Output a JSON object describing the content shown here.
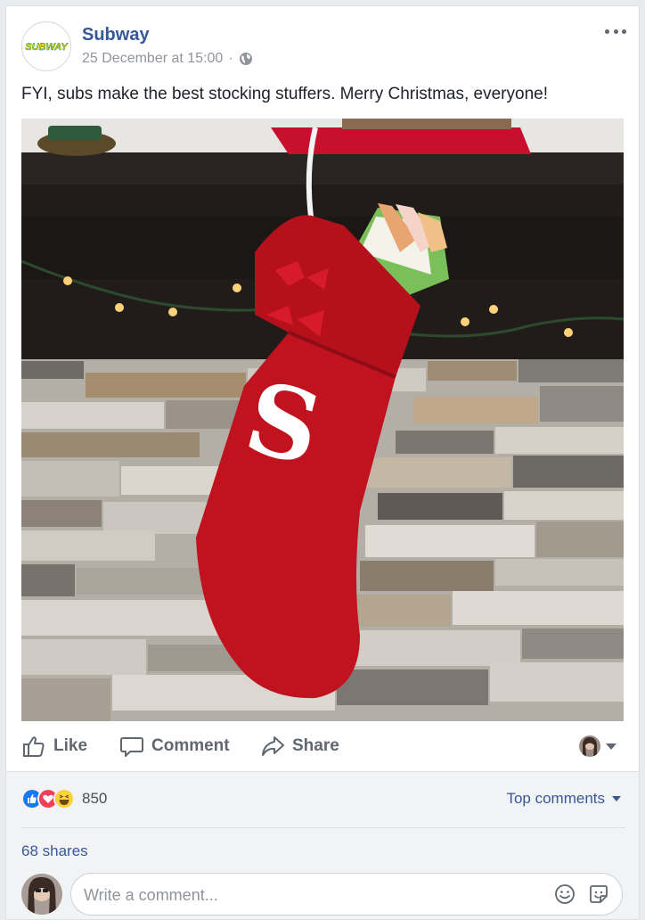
{
  "post": {
    "page_name": "Subway",
    "logo_text": "SUBWAY",
    "timestamp": "25 December at 15:00",
    "separator": "·",
    "audience_icon": "globe-icon",
    "text": "FYI, subs make the best stocking stuffers. Merry Christmas, everyone!",
    "photo_letter": "S"
  },
  "actions": {
    "like": "Like",
    "comment": "Comment",
    "share": "Share"
  },
  "engagement": {
    "reaction_icons": [
      "like-reaction-icon",
      "love-reaction-icon",
      "haha-reaction-icon"
    ],
    "reaction_count": "850",
    "top_comments": "Top comments",
    "shares": "68 shares"
  },
  "composer": {
    "placeholder": "Write a comment..."
  },
  "colors": {
    "link_blue": "#365899",
    "subway_green": "#008c15",
    "subway_yellow": "#ffc600",
    "stocking_red": "#c1121f"
  }
}
